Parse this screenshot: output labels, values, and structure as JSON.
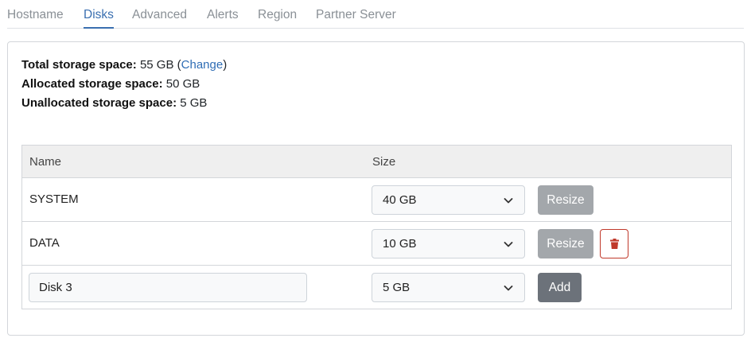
{
  "tabs": [
    {
      "label": "Hostname",
      "active": false
    },
    {
      "label": "Disks",
      "active": true
    },
    {
      "label": "Advanced",
      "active": false
    },
    {
      "label": "Alerts",
      "active": false
    },
    {
      "label": "Region",
      "active": false
    },
    {
      "label": "Partner Server",
      "active": false
    }
  ],
  "storage": {
    "total_label": "Total storage space:",
    "total_value": "55 GB",
    "change_open": "(",
    "change_link": "Change",
    "change_close": ")",
    "allocated_label": "Allocated storage space:",
    "allocated_value": "50 GB",
    "unallocated_label": "Unallocated storage space:",
    "unallocated_value": "5 GB"
  },
  "table": {
    "headers": {
      "name": "Name",
      "size": "Size"
    },
    "rows": [
      {
        "name": "SYSTEM",
        "size": "40 GB",
        "action": "Resize"
      },
      {
        "name": "DATA",
        "size": "10 GB",
        "action": "Resize"
      }
    ],
    "new_disk": {
      "name_value": "Disk 3",
      "size": "5 GB",
      "action": "Add"
    }
  },
  "colors": {
    "accent": "#3a6fb0",
    "resize_button": "#a3a7ab",
    "add_button": "#6c727a",
    "delete_icon": "#c0392b"
  },
  "icons": {
    "select_chevron": "chevron-down-icon",
    "delete": "trash-icon"
  }
}
